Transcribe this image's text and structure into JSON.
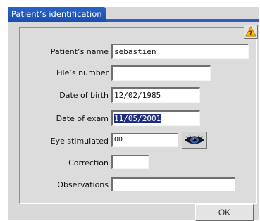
{
  "window": {
    "title": "Patient’s identification"
  },
  "help_button": {
    "icon": "help-icon",
    "glyph": "?",
    "color": "#f2c400"
  },
  "fields": {
    "name": {
      "label": "Patient’s name",
      "value": "sebastien"
    },
    "file_number": {
      "label": "File’s number",
      "value": ""
    },
    "date_of_birth": {
      "label": "Date of birth",
      "value": "12/02/1985"
    },
    "date_of_exam": {
      "label": "Date of exam",
      "value": "11/05/2001"
    },
    "eye": {
      "label": "Eye stimulated",
      "value": "OD",
      "button_icon": "eye-icon"
    },
    "correction": {
      "label": "Correction",
      "value": ""
    },
    "observations": {
      "label": "Observations",
      "value": ""
    }
  },
  "buttons": {
    "ok": "OK"
  },
  "colors": {
    "titlebar": "#2a63c6",
    "selection": "#1e2f80",
    "dialog_bg": "#d9d9d9"
  }
}
